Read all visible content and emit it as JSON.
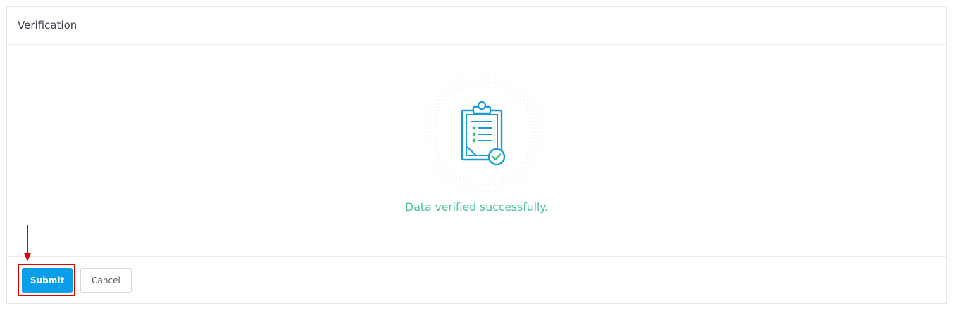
{
  "header": {
    "title": "Verification"
  },
  "body": {
    "illustration_icon": "clipboard-check-icon",
    "message": "Data verified successfully."
  },
  "footer": {
    "submit_label": "Submit",
    "cancel_label": "Cancel"
  },
  "colors": {
    "primary": "#0a9ee8",
    "success_text": "#4fc38f",
    "highlight": "#e00000"
  }
}
